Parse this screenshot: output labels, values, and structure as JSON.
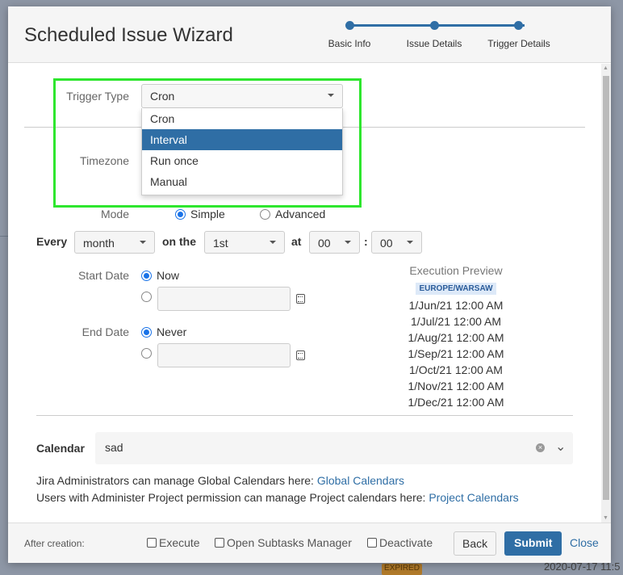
{
  "background": {
    "badge": "EXPIRED",
    "date": "2020-07-17 11:5"
  },
  "header": {
    "title": "Scheduled Issue Wizard",
    "steps": [
      "Basic Info",
      "Issue Details",
      "Trigger Details"
    ]
  },
  "trigger": {
    "label": "Trigger Type",
    "value": "Cron",
    "options": [
      "Cron",
      "Interval",
      "Run once",
      "Manual"
    ],
    "highlighted": "Interval"
  },
  "timezone": {
    "label": "Timezone"
  },
  "mode": {
    "label": "Mode",
    "simple": "Simple",
    "advanced": "Advanced",
    "selected": "Simple"
  },
  "every": {
    "label": "Every",
    "period": "month",
    "on_the_label": "on the",
    "day": "1st",
    "at_label": "at",
    "hour": "00",
    "colon": ":",
    "minute": "00"
  },
  "start_date": {
    "label": "Start Date",
    "now": "Now"
  },
  "end_date": {
    "label": "End Date",
    "never": "Never"
  },
  "preview": {
    "title": "Execution Preview",
    "timezone": "EUROPE/WARSAW",
    "dates": [
      "1/Jun/21 12:00 AM",
      "1/Jul/21 12:00 AM",
      "1/Aug/21 12:00 AM",
      "1/Sep/21 12:00 AM",
      "1/Oct/21 12:00 AM",
      "1/Nov/21 12:00 AM",
      "1/Dec/21 12:00 AM"
    ]
  },
  "calendar": {
    "label": "Calendar",
    "value": "sad"
  },
  "help": {
    "line1": "Jira Administrators can manage Global Calendars here: ",
    "link1": "Global Calendars",
    "line2": "Users with Administer Project permission can manage Project calendars here: ",
    "link2": "Project Calendars"
  },
  "footer": {
    "after_creation": "After creation:",
    "execute": "Execute",
    "open_subtasks": "Open Subtasks Manager",
    "deactivate": "Deactivate",
    "back": "Back",
    "submit": "Submit",
    "close": "Close"
  },
  "colors": {
    "accent": "#2f6ea5",
    "highlight_box": "#2ee62e"
  }
}
